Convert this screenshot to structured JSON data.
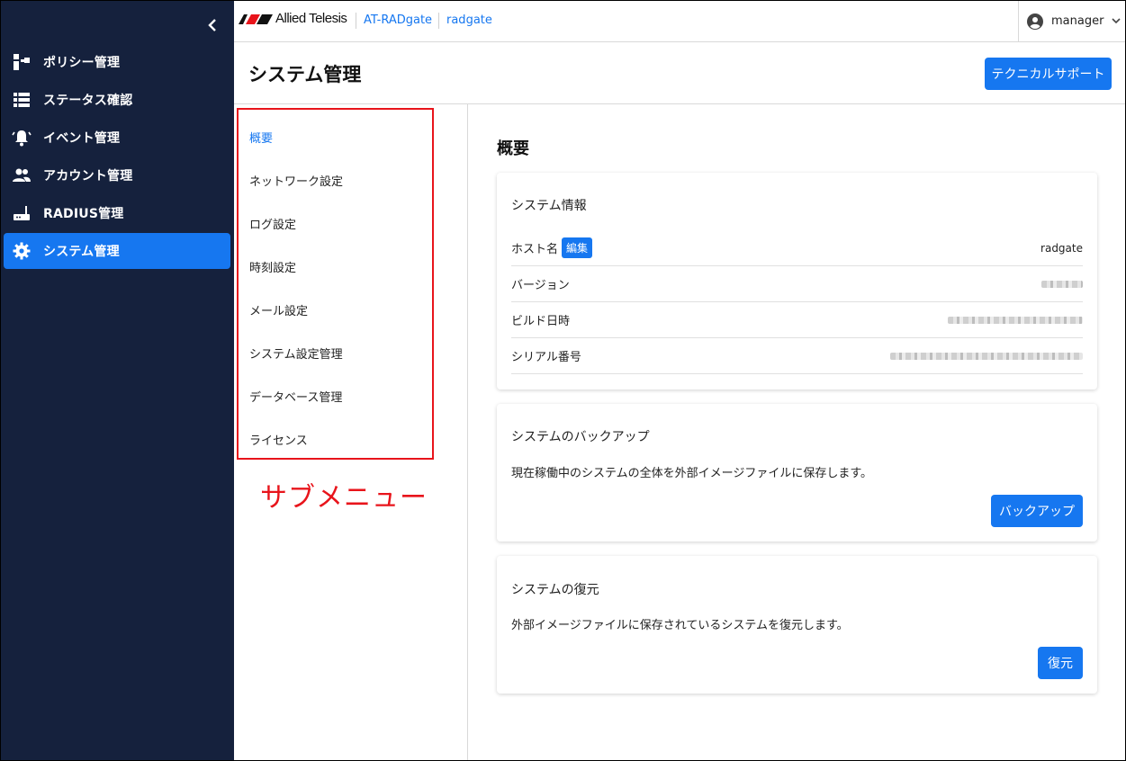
{
  "sidebar": {
    "items": [
      {
        "label": "ポリシー管理",
        "icon": "policy-icon"
      },
      {
        "label": "ステータス確認",
        "icon": "list-icon"
      },
      {
        "label": "イベント管理",
        "icon": "bell-icon"
      },
      {
        "label": "アカウント管理",
        "icon": "people-icon"
      },
      {
        "label": "RADIUS管理",
        "icon": "router-icon"
      },
      {
        "label": "システム管理",
        "icon": "gear-icon",
        "active": true
      }
    ]
  },
  "topbar": {
    "brand": "Allied Telesis",
    "product": "AT-RADgate",
    "host": "radgate",
    "user": "manager"
  },
  "header": {
    "title": "システム管理",
    "support_label": "テクニカルサポート"
  },
  "submenu": {
    "items": [
      {
        "label": "概要",
        "active": true
      },
      {
        "label": "ネットワーク設定"
      },
      {
        "label": "ログ設定"
      },
      {
        "label": "時刻設定"
      },
      {
        "label": "メール設定"
      },
      {
        "label": "システム設定管理"
      },
      {
        "label": "データベース管理"
      },
      {
        "label": "ライセンス"
      }
    ],
    "annotation": "サブメニュー"
  },
  "content": {
    "section_title": "概要",
    "system_info": {
      "title": "システム情報",
      "rows": [
        {
          "label": "ホスト名",
          "value": "radgate",
          "edit_label": "編集"
        },
        {
          "label": "バージョン"
        },
        {
          "label": "ビルド日時"
        },
        {
          "label": "シリアル番号"
        }
      ]
    },
    "backup": {
      "title": "システムのバックアップ",
      "description": "現在稼働中のシステムの全体を外部イメージファイルに保存します。",
      "button": "バックアップ"
    },
    "restore": {
      "title": "システムの復元",
      "description": "外部イメージファイルに保存されているシステムを復元します。",
      "button": "復元"
    }
  },
  "colors": {
    "sidebar_bg": "#15213d",
    "accent": "#1677f0",
    "annotation": "#e8141b"
  }
}
